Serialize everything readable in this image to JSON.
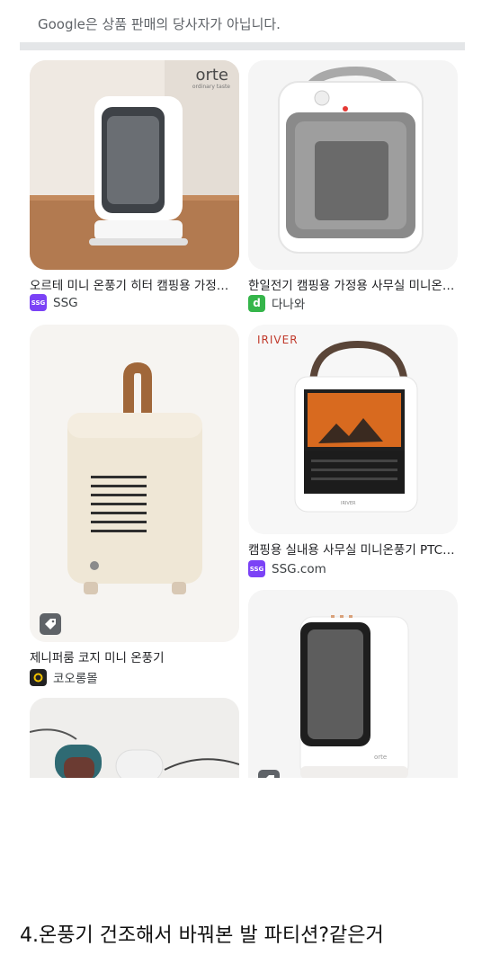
{
  "top_card": {
    "text": "Google은 상품 판매의 당사자가 아닙니다."
  },
  "results": [
    {
      "title": "오르테 미니 온풍기 히터 캠핑용 가정용 사무실 미니 온풍기",
      "source": "SSG",
      "favicon_color": "#7b42f6",
      "favicon_text": "SSG",
      "brand_text": "orte",
      "brand_sub": "ordinary taste"
    },
    {
      "title": "한일전기 캠핑용 가정용 사무실 미니온풍기",
      "source": "다나와",
      "favicon_color": "#35b54a",
      "favicon_text": "d"
    },
    {
      "title": "제니퍼룸 코지 미니 온풍기",
      "source": "코오롱몰",
      "favicon_color": "#222222",
      "favicon_text": "",
      "tag_icon": "price-tag-icon"
    },
    {
      "title": "캠핑용 실내용 사무실 미니온풍기 PTC 히터",
      "source": "SSG.com",
      "favicon_color": "#7b42f6",
      "favicon_text": "SSG",
      "brand_text": "IRIVER",
      "device_brand": "IRIVER"
    },
    {
      "title": "",
      "source": ""
    },
    {
      "title": "",
      "source": "",
      "device_brand": "orte"
    }
  ],
  "heading": "4.온풍기 건조해서 바꿔본 발 파티션?같은거"
}
